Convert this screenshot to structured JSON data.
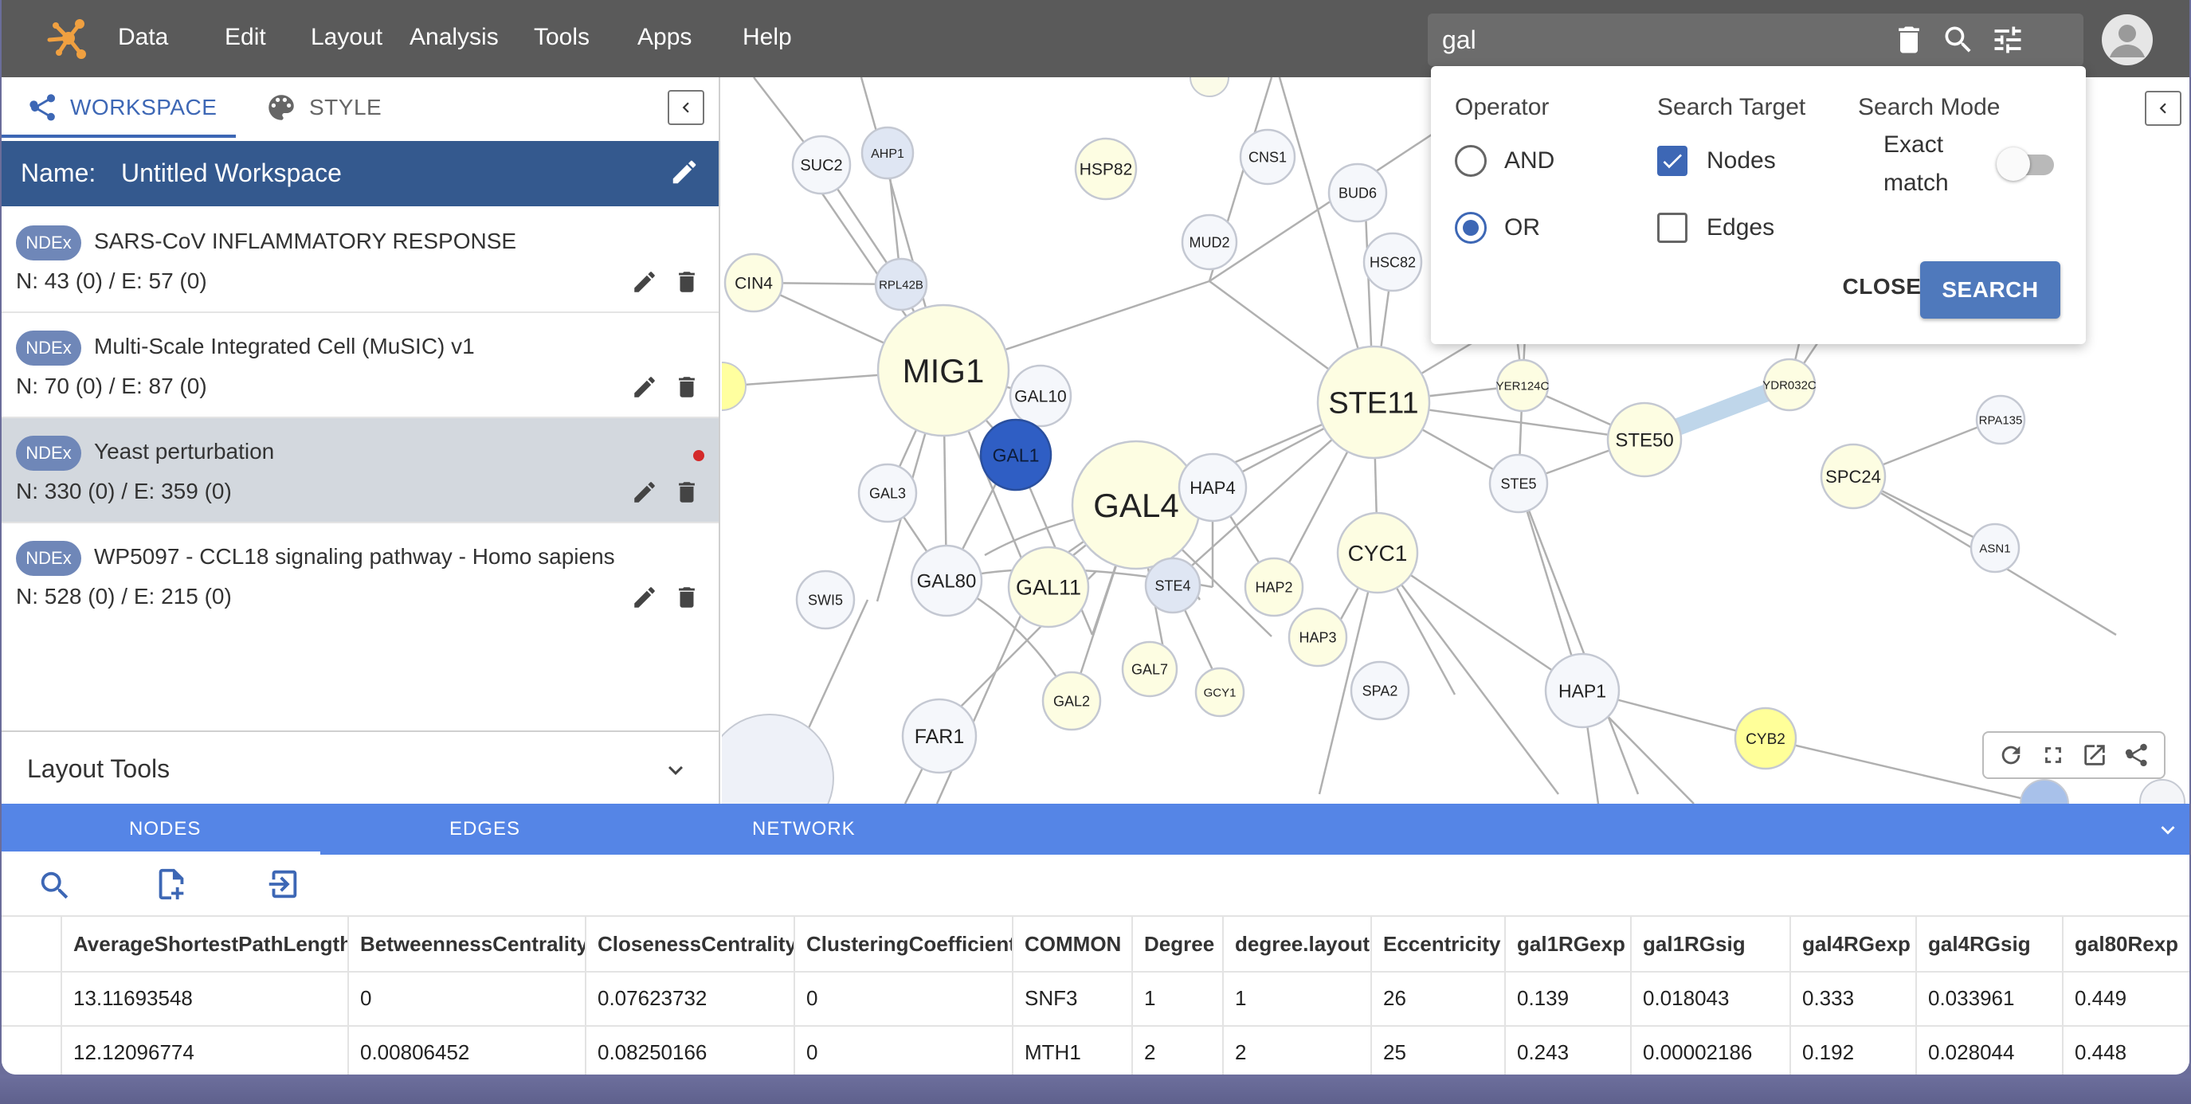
{
  "colors": {
    "topbar": "#5a5a5a",
    "accent": "#3d67b5",
    "name_bar": "#34598e",
    "table_tabs": "#5585e6",
    "node_selected": "#2f5ec4",
    "node_yellow": "#ffff99"
  },
  "topbar": {
    "menu": [
      "Data",
      "Edit",
      "Layout",
      "Analysis",
      "Tools",
      "Apps",
      "Help"
    ],
    "search_value": "gal",
    "icons": [
      "trash-icon",
      "search-icon",
      "tune-icon",
      "account-icon"
    ]
  },
  "left_panel": {
    "tabs": {
      "workspace": "WORKSPACE",
      "style": "STYLE"
    },
    "name_label": "Name:",
    "workspace_name": "Untitled Workspace",
    "networks": [
      {
        "badge": "NDEx",
        "title": "SARS-CoV INFLAMMATORY RESPONSE",
        "stats": "N: 43 (0) / E: 57 (0)"
      },
      {
        "badge": "NDEx",
        "title": "Multi-Scale Integrated Cell (MuSIC) v1",
        "stats": "N: 70 (0) / E: 87 (0)"
      },
      {
        "badge": "NDEx",
        "title": "Yeast perturbation",
        "stats": "N: 330 (0) / E: 359 (0)"
      },
      {
        "badge": "NDEx",
        "title": "WP5097 - CCL18 signaling pathway - Homo sapiens",
        "stats": "N: 528 (0) / E: 215 (0)"
      }
    ],
    "layout_tools": "Layout Tools"
  },
  "search_popup": {
    "operator_heading": "Operator",
    "target_heading": "Search Target",
    "mode_heading": "Search Mode",
    "and_label": "AND",
    "or_label": "OR",
    "nodes_label": "Nodes",
    "edges_label": "Edges",
    "exact_line1": "Exact",
    "exact_line2": "match",
    "close": "CLOSE",
    "search": "SEARCH"
  },
  "graph_nodes": [
    "SUC2",
    "AHP1",
    "HSP82",
    "CNS1",
    "BUD6",
    "MUD2",
    "HSC82",
    "CIN4",
    "RPL42B",
    "MIG1",
    "GAL10",
    "STE11",
    "YER124C",
    "YDR032C",
    "RPA135",
    "GAL1",
    "STE50",
    "GAL4",
    "HAP4",
    "GAL3",
    "STE5",
    "SPC24",
    "CYC1",
    "ASN1",
    "STE4",
    "GAL80",
    "GAL11",
    "HAP2",
    "SWI5",
    "HAP3",
    "GAL7",
    "GCY1",
    "SPA2",
    "HAP1",
    "CYB2",
    "GAL2",
    "FAR1"
  ],
  "table": {
    "tabs": [
      "NODES",
      "EDGES",
      "NETWORK"
    ],
    "columns": [
      "AverageShortestPathLength",
      "BetweennessCentrality",
      "ClosenessCentrality",
      "ClusteringCoefficient",
      "COMMON",
      "Degree",
      "degree.layout",
      "Eccentricity",
      "gal1RGexp",
      "gal1RGsig",
      "gal4RGexp",
      "gal4RGsig",
      "gal80Rexp"
    ],
    "rows": [
      [
        "13.11693548",
        "0",
        "0.07623732",
        "0",
        "SNF3",
        "1",
        "1",
        "26",
        "0.139",
        "0.018043",
        "0.333",
        "0.033961",
        "0.449"
      ],
      [
        "12.12096774",
        "0.00806452",
        "0.08250166",
        "0",
        "MTH1",
        "2",
        "2",
        "25",
        "0.243",
        "0.00002186",
        "0.192",
        "0.028044",
        "0.448"
      ]
    ]
  }
}
